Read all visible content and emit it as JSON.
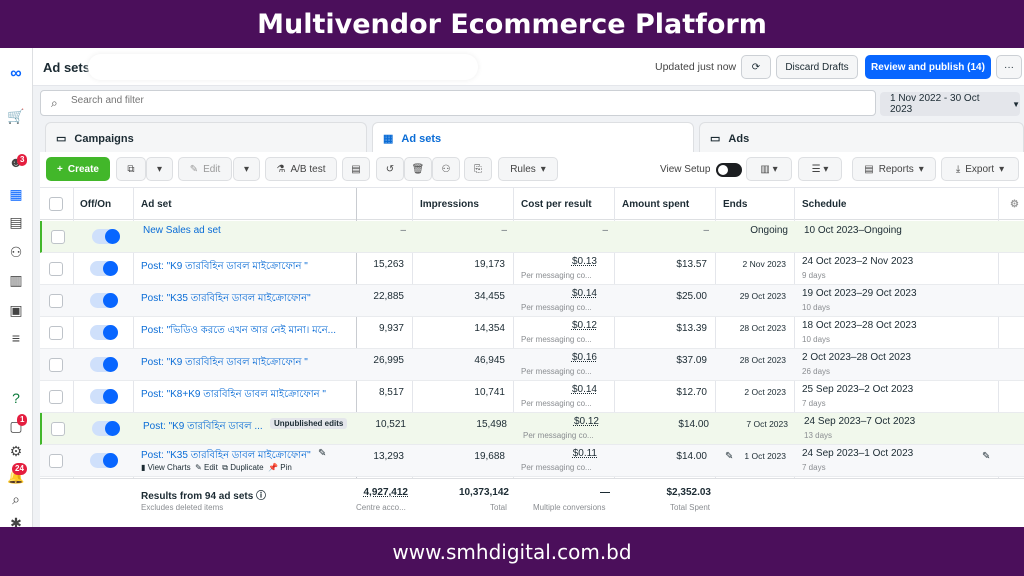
{
  "banner": {
    "title": "Multivendor Ecommerce Platform",
    "url": "www.smhdigital.com.bd"
  },
  "rail": {
    "badges": [
      "3",
      "1",
      "24"
    ]
  },
  "topbar": {
    "title": "Ad sets",
    "updated": "Updated just now",
    "discard": "Discard Drafts",
    "publish": "Review and publish (14)",
    "more": "···"
  },
  "search": {
    "placeholder": "Search and filter"
  },
  "date_range": "1 Nov 2022 - 30 Oct 2023",
  "tabs": [
    {
      "label": "Campaigns"
    },
    {
      "label": "Ad sets"
    },
    {
      "label": "Ads"
    }
  ],
  "toolbar": {
    "create": "Create",
    "edit": "Edit",
    "ab": "A/B test",
    "rules": "Rules",
    "view_setup": "View Setup",
    "reports": "Reports",
    "export": "Export"
  },
  "columns": {
    "offon": "Off/On",
    "adset": "Ad set",
    "impressions": "Impressions",
    "cpr": "Cost per result",
    "spent": "Amount spent",
    "ends": "Ends",
    "schedule": "Schedule"
  },
  "rows": [
    {
      "name": "New Sales ad set",
      "reach": "–",
      "impressions": "–",
      "cpr": "–",
      "cpr_sub": "",
      "spent": "–",
      "ends": "Ongoing",
      "schedule": "10 Oct 2023–Ongoing",
      "days": ""
    },
    {
      "name": "Post: \"K9 তারবিহিন ডাবল মাইক্রোফোন \"",
      "reach": "15,263",
      "impressions": "19,173",
      "cpr": "$0.13",
      "cpr_sub": "Per messaging co...",
      "spent": "$13.57",
      "ends": "2 Nov 2023",
      "schedule": "24 Oct 2023–2 Nov 2023",
      "days": "9 days"
    },
    {
      "name": "Post: \"K35 তারবিহিন ডাবল মাইক্রোফোন\"",
      "reach": "22,885",
      "impressions": "34,455",
      "cpr": "$0.14",
      "cpr_sub": "Per messaging co...",
      "spent": "$25.00",
      "ends": "29 Oct 2023",
      "schedule": "19 Oct 2023–29 Oct 2023",
      "days": "10 days"
    },
    {
      "name": "Post: \"ভিডিও করতে এখন আর নেই মানা। মনে...",
      "reach": "9,937",
      "impressions": "14,354",
      "cpr": "$0.12",
      "cpr_sub": "Per messaging co...",
      "spent": "$13.39",
      "ends": "28 Oct 2023",
      "schedule": "18 Oct 2023–28 Oct 2023",
      "days": "10 days"
    },
    {
      "name": "Post: \"K9 তারবিহিন ডাবল মাইক্রোফোন \"",
      "reach": "26,995",
      "impressions": "46,945",
      "cpr": "$0.16",
      "cpr_sub": "Per messaging co...",
      "spent": "$37.09",
      "ends": "28 Oct 2023",
      "schedule": "2 Oct 2023–28 Oct 2023",
      "days": "26 days"
    },
    {
      "name": "Post: \"K8+K9 তারবিহিন ডাবল মাইক্রোফোন \"",
      "reach": "8,517",
      "impressions": "10,741",
      "cpr": "$0.14",
      "cpr_sub": "Per messaging co...",
      "spent": "$12.70",
      "ends": "2 Oct 2023",
      "schedule": "25 Sep 2023–2 Oct 2023",
      "days": "7 days"
    },
    {
      "name": "Post: \"K9 তারবিহিন ডাবল ...",
      "badge": "Unpublished edits",
      "reach": "10,521",
      "impressions": "15,498",
      "cpr": "$0.12",
      "cpr_sub": "Per messaging co...",
      "spent": "$14.00",
      "ends": "7 Oct 2023",
      "schedule": "24 Sep 2023–7 Oct 2023",
      "days": "13 days"
    },
    {
      "name": "Post: \"K35 তারবিহিন ডাবল মাইক্রোফোন\"",
      "reach": "13,293",
      "impressions": "19,688",
      "cpr": "$0.11",
      "cpr_sub": "Per messaging co...",
      "spent": "$14.00",
      "ends": "1 Oct 2023",
      "schedule": "24 Sep 2023–1 Oct 2023",
      "days": "7 days",
      "actions": [
        "View Charts",
        "Edit",
        "Duplicate",
        "Pin"
      ]
    }
  ],
  "footer": {
    "results": "Results from 94 ad sets",
    "excluded": "Excludes deleted items",
    "reach": "4,927,412",
    "reach_sub": "Centre acco...",
    "impressions": "10,373,142",
    "impressions_sub": "Total",
    "cpr": "—",
    "cpr_sub": "Multiple conversions",
    "spent": "$2,352.03",
    "spent_sub": "Total Spent"
  }
}
